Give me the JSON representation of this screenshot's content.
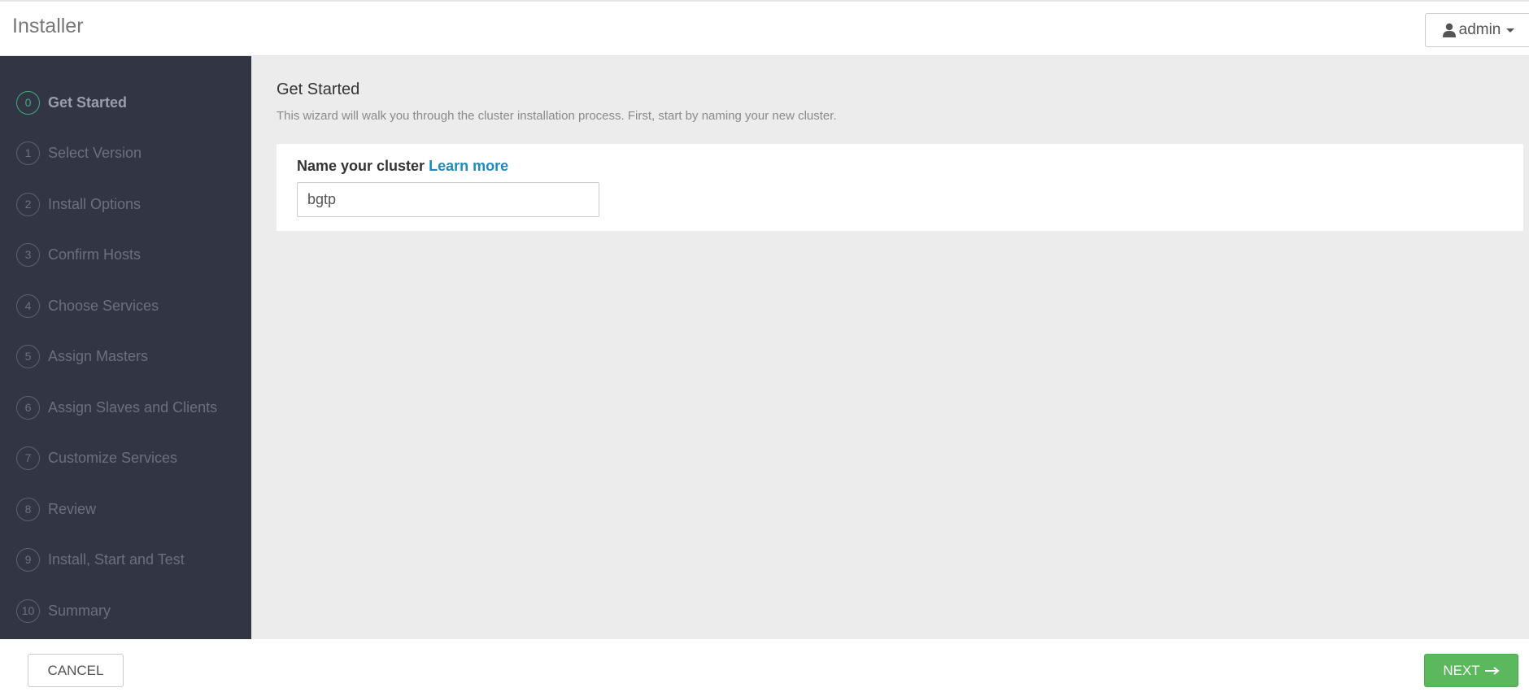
{
  "header": {
    "app_title": "Installer",
    "user_menu_label": "admin",
    "user_icon": "user-icon",
    "caret_icon": "caret-down-icon"
  },
  "sidebar": {
    "steps": [
      {
        "number": "0",
        "label": "Get Started",
        "active": true
      },
      {
        "number": "1",
        "label": "Select Version",
        "active": false
      },
      {
        "number": "2",
        "label": "Install Options",
        "active": false
      },
      {
        "number": "3",
        "label": "Confirm Hosts",
        "active": false
      },
      {
        "number": "4",
        "label": "Choose Services",
        "active": false
      },
      {
        "number": "5",
        "label": "Assign Masters",
        "active": false
      },
      {
        "number": "6",
        "label": "Assign Slaves and Clients",
        "active": false
      },
      {
        "number": "7",
        "label": "Customize Services",
        "active": false
      },
      {
        "number": "8",
        "label": "Review",
        "active": false
      },
      {
        "number": "9",
        "label": "Install, Start and Test",
        "active": false
      },
      {
        "number": "10",
        "label": "Summary",
        "active": false
      }
    ]
  },
  "main": {
    "title": "Get Started",
    "description": "This wizard will walk you through the cluster installation process. First, start by naming your new cluster.",
    "name_label": "Name your cluster",
    "learn_more": "Learn more",
    "cluster_name_value": "bgtp"
  },
  "footer": {
    "cancel_label": "CANCEL",
    "next_label": "NEXT",
    "next_icon": "arrow-right-icon"
  },
  "colors": {
    "sidebar_bg": "#323544",
    "active_step": "#3fae7a",
    "link": "#1f8ac0",
    "next_button": "#5cb85c",
    "content_bg": "#ececec"
  }
}
